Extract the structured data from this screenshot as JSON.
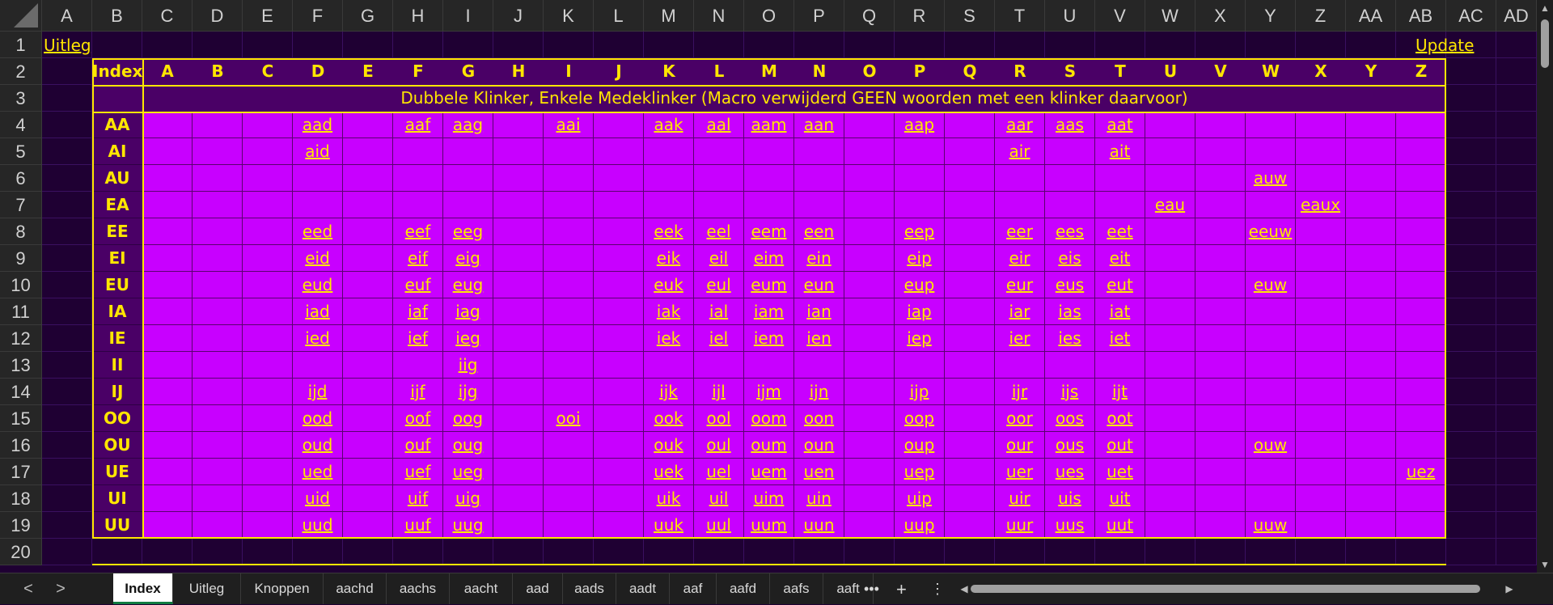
{
  "columns": [
    "A",
    "B",
    "C",
    "D",
    "E",
    "F",
    "G",
    "H",
    "I",
    "J",
    "K",
    "L",
    "M",
    "N",
    "O",
    "P",
    "Q",
    "R",
    "S",
    "T",
    "U",
    "V",
    "W",
    "X",
    "Y",
    "Z",
    "AA",
    "AB",
    "AC",
    "AD"
  ],
  "rows": [
    "1",
    "2",
    "3",
    "4",
    "5",
    "6",
    "7",
    "8",
    "9",
    "10",
    "11",
    "12",
    "13",
    "14",
    "15",
    "16",
    "17",
    "18",
    "19",
    "20"
  ],
  "links": {
    "uitleg": "Uitleg",
    "update": "Update"
  },
  "index_header": "Index",
  "letters": [
    "A",
    "B",
    "C",
    "D",
    "E",
    "F",
    "G",
    "H",
    "I",
    "J",
    "K",
    "L",
    "M",
    "N",
    "O",
    "P",
    "Q",
    "R",
    "S",
    "T",
    "U",
    "V",
    "W",
    "X",
    "Y",
    "Z"
  ],
  "banner": "Dubbele Klinker, Enkele Medeklinker (Macro verwijderd GEEN woorden met een klinker daarvoor)",
  "index_rows": [
    "AA",
    "AI",
    "AU",
    "EA",
    "EE",
    "EI",
    "EU",
    "IA",
    "IE",
    "II",
    "IJ",
    "OO",
    "OU",
    "UE",
    "UI",
    "UU"
  ],
  "table": [
    [
      "",
      "",
      "",
      "aad",
      "",
      "aaf",
      "aag",
      "",
      "aai",
      "",
      "aak",
      "aal",
      "aam",
      "aan",
      "",
      "aap",
      "",
      "aar",
      "aas",
      "aat",
      "",
      "",
      "",
      "",
      "",
      ""
    ],
    [
      "",
      "",
      "",
      "aid",
      "",
      "",
      "",
      "",
      "",
      "",
      "",
      "",
      "",
      "",
      "",
      "",
      "",
      "air",
      "",
      "ait",
      "",
      "",
      "",
      "",
      "",
      ""
    ],
    [
      "",
      "",
      "",
      "",
      "",
      "",
      "",
      "",
      "",
      "",
      "",
      "",
      "",
      "",
      "",
      "",
      "",
      "",
      "",
      "",
      "",
      "",
      "auw",
      "",
      "",
      ""
    ],
    [
      "",
      "",
      "",
      "",
      "",
      "",
      "",
      "",
      "",
      "",
      "",
      "",
      "",
      "",
      "",
      "",
      "",
      "",
      "",
      "",
      "eau",
      "",
      "",
      "eaux",
      "",
      ""
    ],
    [
      "",
      "",
      "",
      "eed",
      "",
      "eef",
      "eeg",
      "",
      "",
      "",
      "eek",
      "eel",
      "eem",
      "een",
      "",
      "eep",
      "",
      "eer",
      "ees",
      "eet",
      "",
      "",
      "eeuw",
      "",
      "",
      ""
    ],
    [
      "",
      "",
      "",
      "eid",
      "",
      "eif",
      "eig",
      "",
      "",
      "",
      "eik",
      "eil",
      "eim",
      "ein",
      "",
      "eip",
      "",
      "eir",
      "eis",
      "eit",
      "",
      "",
      "",
      "",
      "",
      ""
    ],
    [
      "",
      "",
      "",
      "eud",
      "",
      "euf",
      "eug",
      "",
      "",
      "",
      "euk",
      "eul",
      "eum",
      "eun",
      "",
      "eup",
      "",
      "eur",
      "eus",
      "eut",
      "",
      "",
      "euw",
      "",
      "",
      ""
    ],
    [
      "",
      "",
      "",
      "iad",
      "",
      "iaf",
      "iag",
      "",
      "",
      "",
      "iak",
      "ial",
      "iam",
      "ian",
      "",
      "iap",
      "",
      "iar",
      "ias",
      "iat",
      "",
      "",
      "",
      "",
      "",
      ""
    ],
    [
      "",
      "",
      "",
      "ied",
      "",
      "ief",
      "ieg",
      "",
      "",
      "",
      "iek",
      "iel",
      "iem",
      "ien",
      "",
      "iep",
      "",
      "ier",
      "ies",
      "iet",
      "",
      "",
      "",
      "",
      "",
      ""
    ],
    [
      "",
      "",
      "",
      "",
      "",
      "",
      "iig",
      "",
      "",
      "",
      "",
      "",
      "",
      "",
      "",
      "",
      "",
      "",
      "",
      "",
      "",
      "",
      "",
      "",
      "",
      ""
    ],
    [
      "",
      "",
      "",
      "ijd",
      "",
      "ijf",
      "ijg",
      "",
      "",
      "",
      "ijk",
      "ijl",
      "ijm",
      "ijn",
      "",
      "ijp",
      "",
      "ijr",
      "ijs",
      "ijt",
      "",
      "",
      "",
      "",
      "",
      ""
    ],
    [
      "",
      "",
      "",
      "ood",
      "",
      "oof",
      "oog",
      "",
      "ooi",
      "",
      "ook",
      "ool",
      "oom",
      "oon",
      "",
      "oop",
      "",
      "oor",
      "oos",
      "oot",
      "",
      "",
      "",
      "",
      "",
      ""
    ],
    [
      "",
      "",
      "",
      "oud",
      "",
      "ouf",
      "oug",
      "",
      "",
      "",
      "ouk",
      "oul",
      "oum",
      "oun",
      "",
      "oup",
      "",
      "our",
      "ous",
      "out",
      "",
      "",
      "ouw",
      "",
      "",
      ""
    ],
    [
      "",
      "",
      "",
      "ued",
      "",
      "uef",
      "ueg",
      "",
      "",
      "",
      "uek",
      "uel",
      "uem",
      "uen",
      "",
      "uep",
      "",
      "uer",
      "ues",
      "uet",
      "",
      "",
      "",
      "",
      "",
      "uez"
    ],
    [
      "",
      "",
      "",
      "uid",
      "",
      "uif",
      "uig",
      "",
      "",
      "",
      "uik",
      "uil",
      "uim",
      "uin",
      "",
      "uip",
      "",
      "uir",
      "uis",
      "uit",
      "",
      "",
      "",
      "",
      "",
      ""
    ],
    [
      "",
      "",
      "",
      "uud",
      "",
      "uuf",
      "uug",
      "",
      "",
      "",
      "uuk",
      "uul",
      "uum",
      "uun",
      "",
      "uup",
      "",
      "uur",
      "uus",
      "uut",
      "",
      "",
      "uuw",
      "",
      "",
      ""
    ]
  ],
  "sheet_tabs": [
    "Index",
    "Uitleg",
    "Knoppen",
    "aachd",
    "aachs",
    "aacht",
    "aad",
    "aads",
    "aadt",
    "aaf",
    "aafd",
    "aafs",
    "aaft"
  ],
  "active_tab": "Index",
  "tab_more": "•••",
  "tab_add": "+",
  "tab_menu": "⋮",
  "nav": {
    "prev": "<",
    "next": ">"
  },
  "colors": {
    "cell_bg": "#c800ff",
    "header_bg": "#4a0066",
    "text": "#ffe600",
    "sheet_bg": "#1f0033"
  }
}
